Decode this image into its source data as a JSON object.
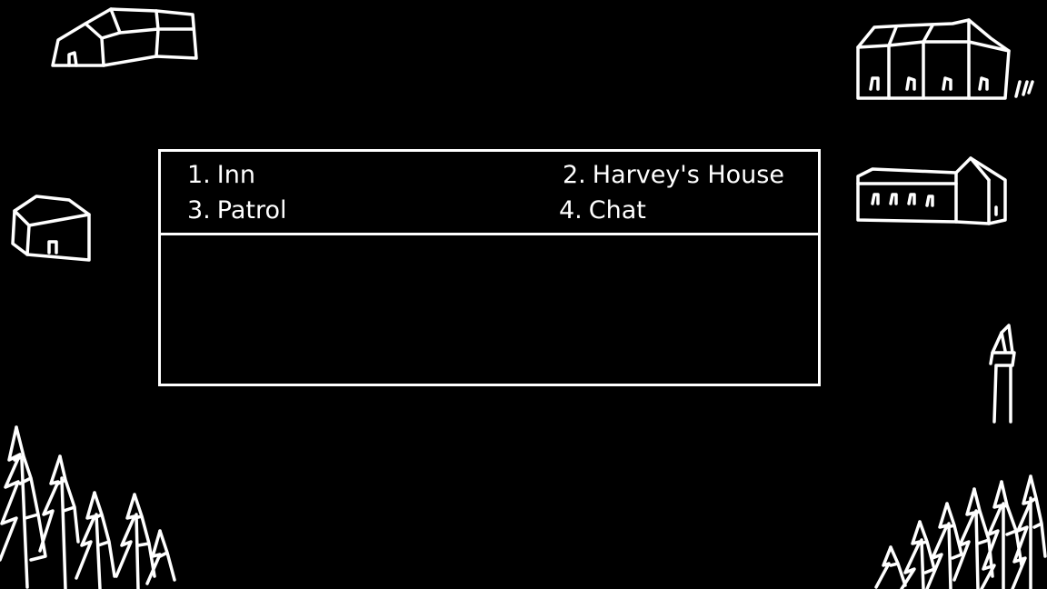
{
  "menu": {
    "options": [
      {
        "number": "1.",
        "label": "Inn"
      },
      {
        "number": "2.",
        "label": "Harvey's House"
      },
      {
        "number": "3.",
        "label": "Patrol"
      },
      {
        "number": "4.",
        "label": "Chat"
      }
    ]
  },
  "dialogue": {
    "text": ""
  },
  "colors": {
    "background": "#000000",
    "line": "#ffffff"
  },
  "icons": [
    "house-icon",
    "inn-icon",
    "cottage-icon",
    "church-icon",
    "tower-icon",
    "pine-trees-icon"
  ]
}
